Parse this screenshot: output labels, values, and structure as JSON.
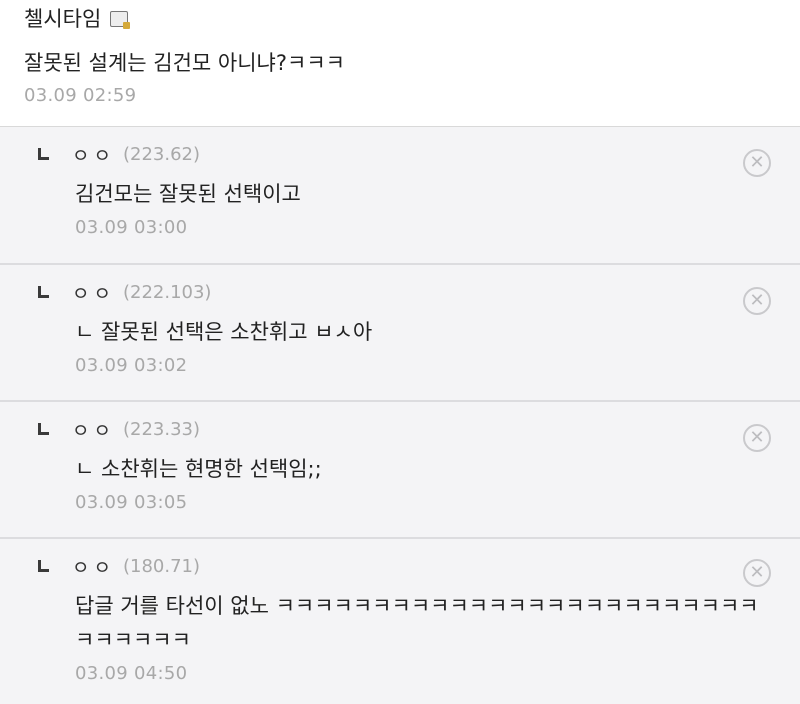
{
  "post": {
    "nickname": "첼시타임",
    "icon": "gallery-nick-icon",
    "text": "잘못된 설계는 김건모 아니냐?ㅋㅋㅋ",
    "date": "03.09 02:59"
  },
  "replies": [
    {
      "name": "ㅇㅇ",
      "ip": "(223.62)",
      "text": "김건모는 잘못된 선택이고",
      "date": "03.09 03:00"
    },
    {
      "name": "ㅇㅇ",
      "ip": "(222.103)",
      "text": "ㄴ 잘못된 선택은 소찬휘고 ㅂㅅ아",
      "date": "03.09 03:02"
    },
    {
      "name": "ㅇㅇ",
      "ip": "(223.33)",
      "text": "ㄴ 소찬휘는 현명한 선택임;;",
      "date": "03.09 03:05"
    },
    {
      "name": "ㅇㅇ",
      "ip": "(180.71)",
      "text": "답글 거를 타선이 없노 ㅋㅋㅋㅋㅋㅋㅋㅋㅋㅋㅋㅋㅋㅋㅋㅋㅋㅋㅋㅋㅋㅋㅋㅋㅋㅋㅋㅋㅋㅋㅋ",
      "date": "03.09 04:50"
    }
  ],
  "icons": {
    "delete": "circle-x-icon",
    "reply_arrow": "reply-arrow-icon"
  },
  "colors": {
    "reply_bg": "#f4f4f6",
    "meta_text": "#a8a8a8",
    "divider": "#dcdcdf"
  }
}
